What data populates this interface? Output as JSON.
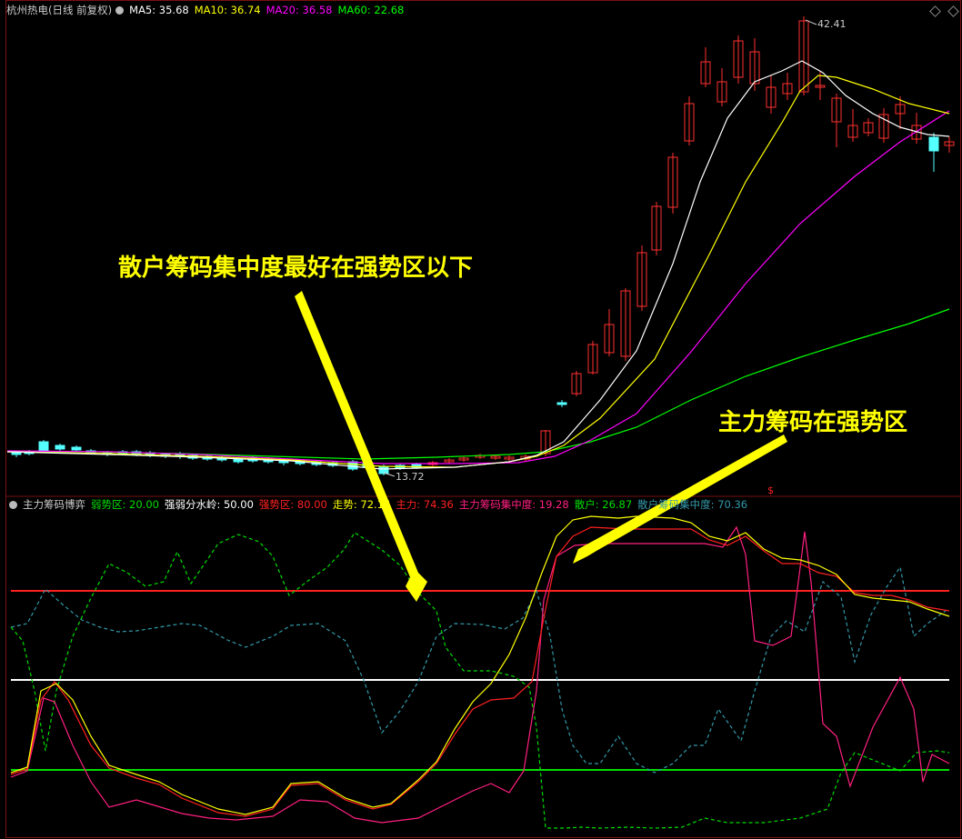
{
  "main_pane": {
    "title": "杭州热电(日线 前复权)",
    "ma": [
      {
        "label": "MA5:",
        "value": "35.68",
        "color": "#ffffff"
      },
      {
        "label": "MA10:",
        "value": "36.74",
        "color": "#ffff00"
      },
      {
        "label": "MA20:",
        "value": "36.58",
        "color": "#ff00ff"
      },
      {
        "label": "MA60:",
        "value": "22.68",
        "color": "#00ff00"
      }
    ],
    "high_marker": "42.41",
    "low_marker": "13.72",
    "signal_marker": "$"
  },
  "indicator_pane": {
    "title": "主力筹码博弈",
    "items": [
      {
        "label": "弱势区:",
        "value": "20.00",
        "color": "#00dd00"
      },
      {
        "label": "强弱分水岭:",
        "value": "50.00",
        "color": "#ffffff"
      },
      {
        "label": "强势区:",
        "value": "80.00",
        "color": "#ff2020"
      },
      {
        "label": "走势:",
        "value": "72.16",
        "color": "#ffff00"
      },
      {
        "label": "主力:",
        "value": "74.36",
        "color": "#ff2020"
      },
      {
        "label": "主力筹码集中度:",
        "value": "19.28",
        "color": "#ff2080"
      },
      {
        "label": "散户:",
        "value": "26.87",
        "color": "#00dd00"
      },
      {
        "label": "散户筹码集中度:",
        "value": "70.36",
        "color": "#3399aa"
      }
    ]
  },
  "annotations": {
    "retail": "散户筹码集中度最好在强势区以下",
    "main": "主力筹码在强势区"
  }
}
